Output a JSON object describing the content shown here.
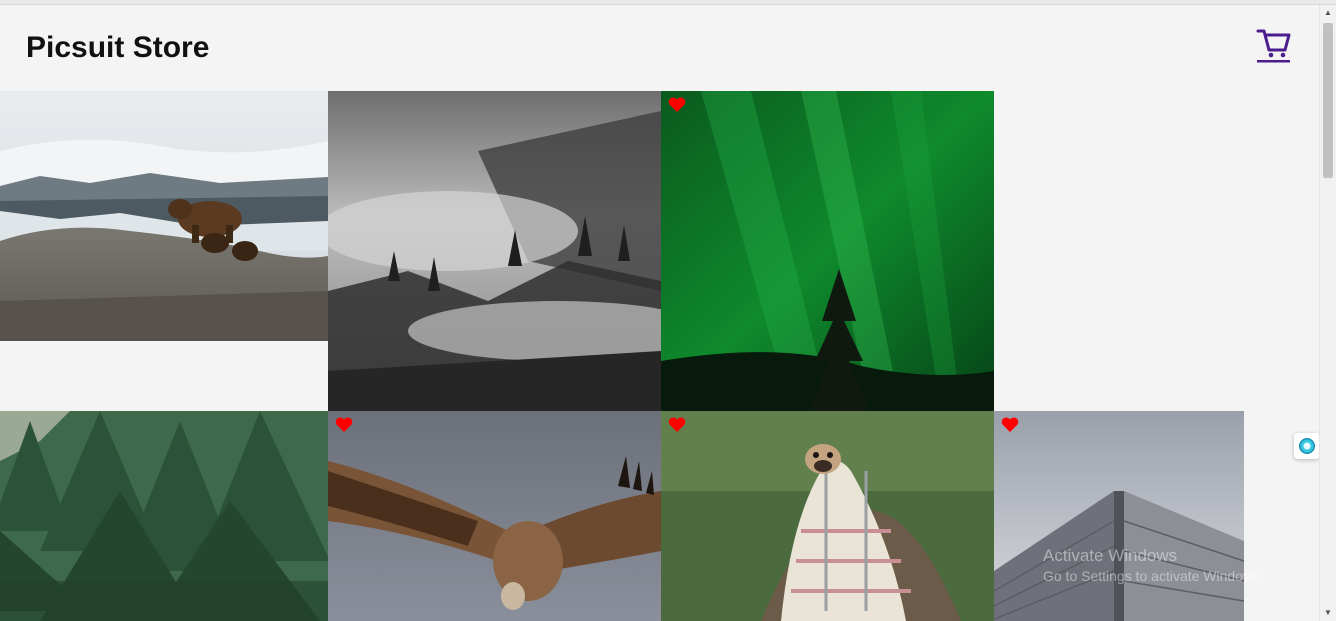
{
  "header": {
    "title": "Picsuit Store",
    "cart_icon": "shopping-cart-icon"
  },
  "colors": {
    "accent": "#4b1d8c",
    "heart": "#ff0000",
    "background": "#f4f4f4"
  },
  "photos": [
    {
      "subject": "bear-with-cubs",
      "favorited": false
    },
    {
      "subject": "misty-forest",
      "favorited": false
    },
    {
      "subject": "northern-lights",
      "favorited": true
    },
    {
      "subject": "pine-trees",
      "favorited": false
    },
    {
      "subject": "vulture",
      "favorited": true
    },
    {
      "subject": "pug-in-blanket",
      "favorited": true
    },
    {
      "subject": "skyscraper",
      "favorited": true
    }
  ],
  "watermark": {
    "title": "Activate Windows",
    "subtitle": "Go to Settings to activate Windows."
  }
}
